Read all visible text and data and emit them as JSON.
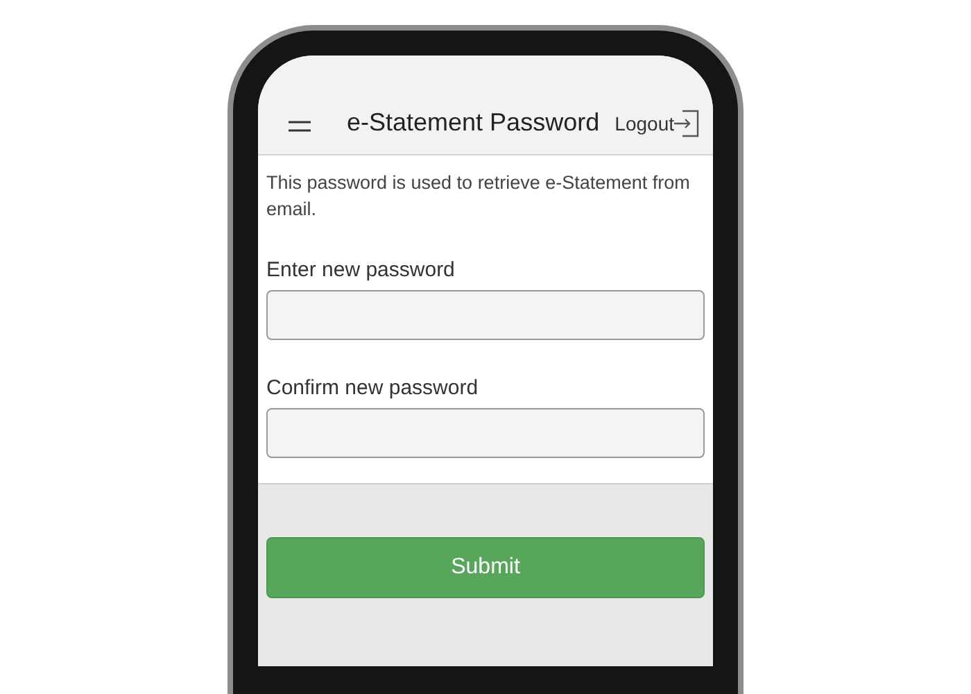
{
  "header": {
    "title": "e-Statement Password",
    "logout": "Logout"
  },
  "description": "This password is used to retrieve e-Statement from email.",
  "fields": [
    {
      "label": "Enter new password"
    },
    {
      "label": "Confirm new password"
    }
  ],
  "submit": "Submit"
}
